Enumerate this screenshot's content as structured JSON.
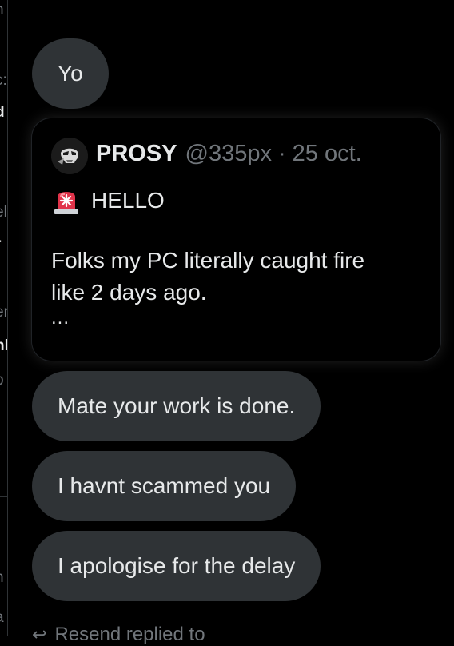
{
  "left_column": {
    "fragments": [
      "n",
      "c:",
      "d",
      "l",
      "el",
      "r",
      "er",
      "nl",
      "p",
      "r",
      "i",
      "n",
      "a"
    ]
  },
  "messages": [
    {
      "text": "Yo"
    },
    {
      "text": "Mate your work is done."
    },
    {
      "text": "I havnt scammed you"
    },
    {
      "text": "I apologise for the delay"
    }
  ],
  "quoted_post": {
    "avatar_icon": "skull-avatar-icon",
    "display_name": "PROSY",
    "handle": "@335px",
    "separator": "·",
    "date": "25 oct.",
    "alert_icon": "police-light-emoji",
    "alert_text": "HELLO",
    "body_line1": "Folks my PC literally caught fire",
    "body_line2": "like 2 days ago.",
    "truncation": "..."
  },
  "reply_hint": {
    "text": "Resend replied to"
  },
  "colors": {
    "background": "#000000",
    "bubble": "#2f3336",
    "text": "#e7e9ea",
    "muted": "#71767b",
    "link": "#1d9bf0"
  }
}
